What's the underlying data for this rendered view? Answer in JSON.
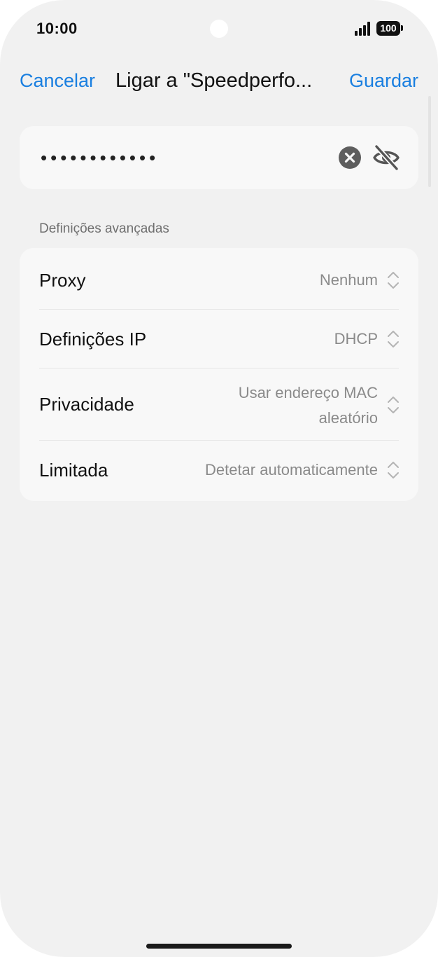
{
  "status_bar": {
    "time": "10:00",
    "battery": "100"
  },
  "nav": {
    "cancel_label": "Cancelar",
    "title": "Ligar a \"Speedperfo...",
    "save_label": "Guardar"
  },
  "password": {
    "masked_value": "••••••••••••",
    "clear_icon": "clear-circle-icon",
    "visibility_icon": "eye-slash-icon"
  },
  "advanced": {
    "header": "Definições avançadas",
    "rows": [
      {
        "label": "Proxy",
        "value": "Nenhum"
      },
      {
        "label": "Definições IP",
        "value": "DHCP"
      },
      {
        "label": "Privacidade",
        "value_line1": "Usar endereço MAC",
        "value_line2": "aleatório"
      },
      {
        "label": "Limitada",
        "value": "Detetar automaticamente"
      }
    ]
  },
  "colors": {
    "accent": "#1a7fe0",
    "background": "#f1f1f1",
    "card": "#f8f8f8"
  }
}
